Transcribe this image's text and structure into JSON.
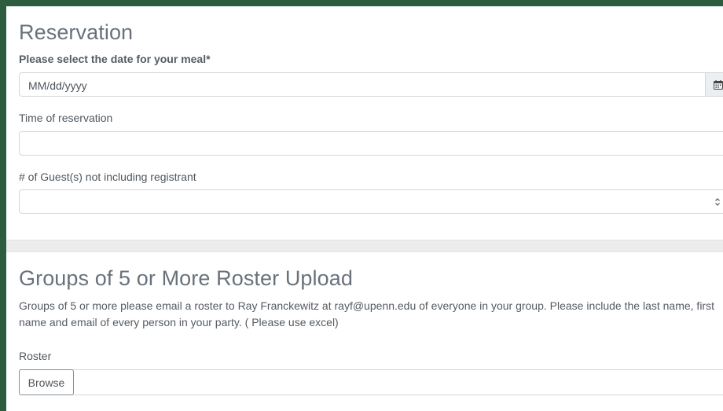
{
  "reservation": {
    "title": "Reservation",
    "date_label": "Please select the date for your meal*",
    "date_placeholder": "MM/dd/yyyy",
    "time_label": "Time of reservation",
    "time_value": "",
    "guests_label": "# of Guest(s) not including registrant",
    "guests_value": ""
  },
  "roster_section": {
    "title": "Groups of 5 or More Roster Upload",
    "description": "Groups of 5 or more please email a roster to Ray Franckewitz at rayf@upenn.edu  of everyone in your group. Please include the last name, first name and email of every person in your party. ( Please use excel)",
    "roster_label": "Roster",
    "browse_label": "Browse"
  },
  "icons": {
    "calendar": "calendar-icon",
    "spinner": "number-spinner-icon"
  },
  "colors": {
    "frame": "#2e5c40",
    "heading": "#68727c",
    "border": "#d3d7db"
  }
}
